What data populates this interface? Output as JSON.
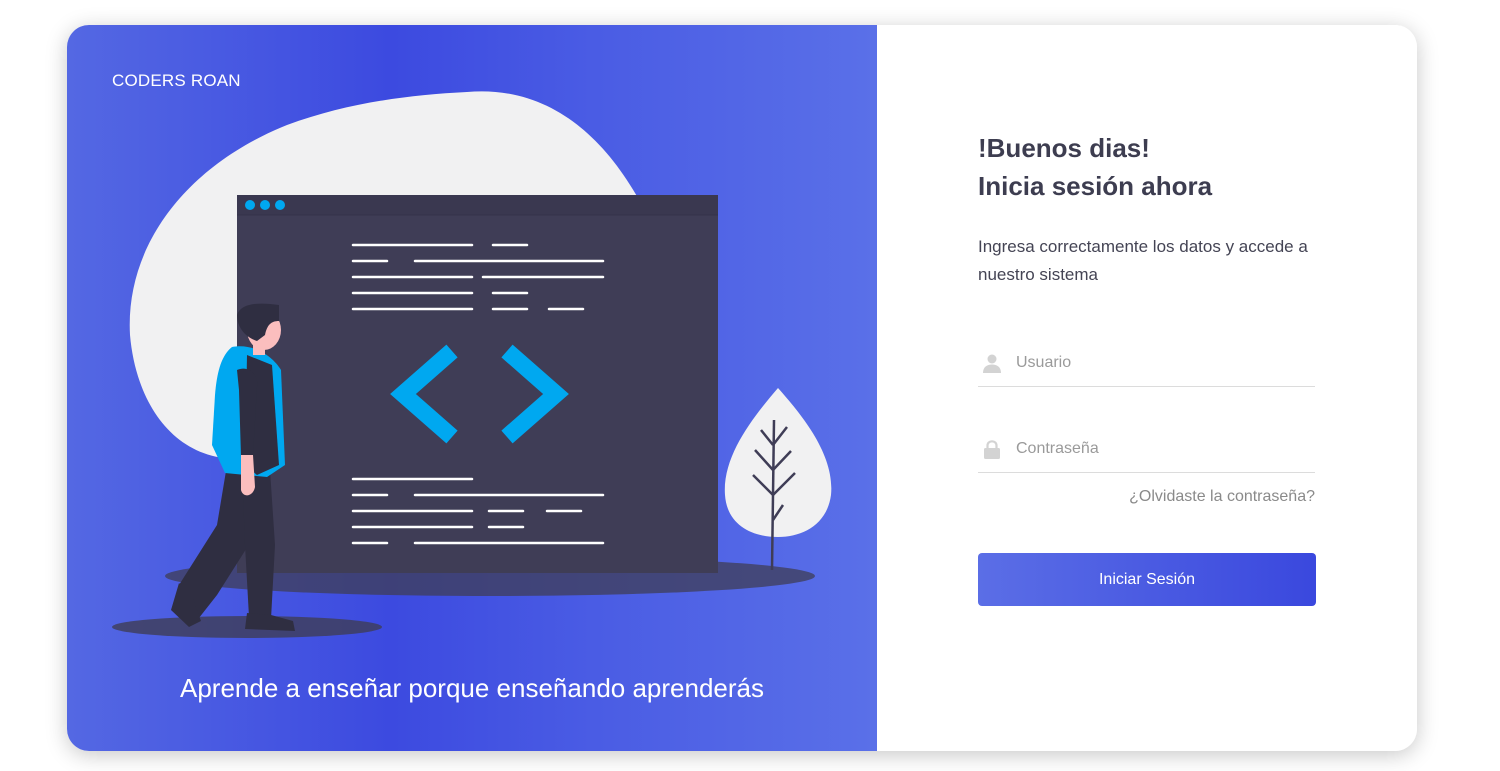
{
  "brand": "CODERS ROAN",
  "tagline": "Aprende a enseñar porque enseñando aprenderás",
  "login": {
    "greeting": "!Buenos dias!",
    "title": "Inicia sesión ahora",
    "subtitle": "Ingresa correctamente los datos y accede a nuestro sistema",
    "username_placeholder": "Usuario",
    "password_placeholder": "Contraseña",
    "forgot_label": "¿Olvidaste la contraseña?",
    "submit_label": "Iniciar Sesión"
  },
  "icons": {
    "username": "user-icon",
    "password": "lock-icon",
    "illustration": "code-window-illustration"
  },
  "colors": {
    "accent": "#3c4ae0",
    "illustration_window": "#3f3d56",
    "illustration_highlight": "#00a8f0",
    "heading_text": "#3d3d50"
  }
}
